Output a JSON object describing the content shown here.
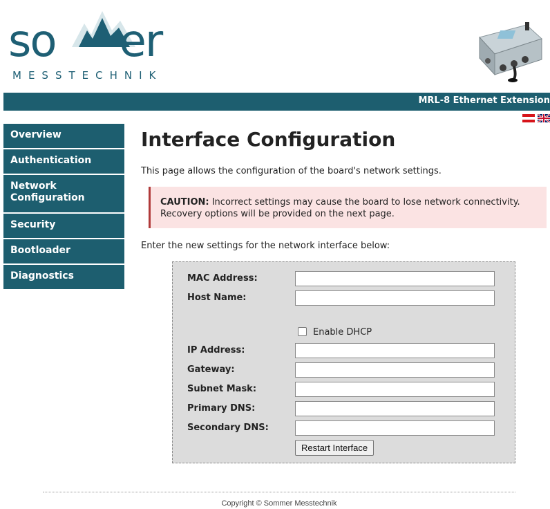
{
  "logo": {
    "word": "so",
    "word_end": "er",
    "subtitle": "MESSTECHNIK"
  },
  "banner": {
    "title": "MRL-8 Ethernet Extension"
  },
  "sidebar": {
    "items": [
      {
        "label": "Overview"
      },
      {
        "label": "Authentication"
      },
      {
        "label": "Network Configuration"
      },
      {
        "label": "Security"
      },
      {
        "label": "Bootloader"
      },
      {
        "label": "Diagnostics"
      }
    ]
  },
  "main": {
    "title": "Interface Configuration",
    "intro": "This page allows the configuration of the board's network settings.",
    "caution_label": "CAUTION:",
    "caution_text": " Incorrect settings may cause the board to lose network connectivity. Recovery options will be provided on the next page.",
    "instructions": "Enter the new settings for the network interface below:"
  },
  "form": {
    "mac_label": "MAC Address:",
    "mac_value": "",
    "host_label": "Host Name:",
    "host_value": "",
    "dhcp_label": "Enable DHCP",
    "dhcp_checked": false,
    "ip_label": "IP Address:",
    "ip_value": "",
    "gateway_label": "Gateway:",
    "gateway_value": "",
    "subnet_label": "Subnet Mask:",
    "subnet_value": "",
    "pdns_label": "Primary DNS:",
    "pdns_value": "",
    "sdns_label": "Secondary DNS:",
    "sdns_value": "",
    "restart_label": "Restart Interface"
  },
  "footer": {
    "copyright": "Copyright © Sommer Messtechnik"
  },
  "colors": {
    "brand": "#1d5e6f",
    "caution_bg": "#fbe3e3",
    "caution_border": "#b03a3a",
    "form_bg": "#dcdcdc"
  },
  "icons": {
    "flag_austria": "flag-austria-icon",
    "flag_uk": "flag-uk-icon",
    "device": "device-image"
  }
}
